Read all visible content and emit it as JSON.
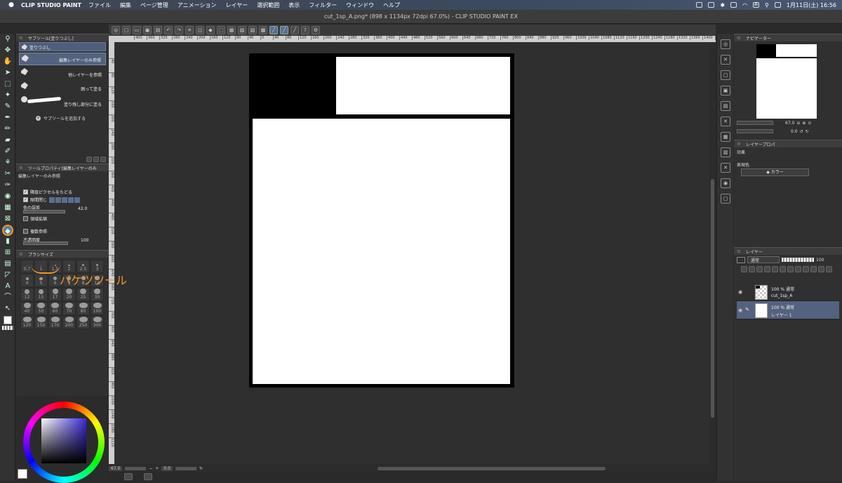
{
  "menubar": {
    "app_name": "CLIP STUDIO PAINT",
    "items": [
      "ファイル",
      "編集",
      "ページ管理",
      "アニメーション",
      "レイヤー",
      "選択範囲",
      "表示",
      "フィルター",
      "ウィンドウ",
      "ヘルプ"
    ],
    "clock": "1月11日(土) 16:56",
    "ime": "あ"
  },
  "window": {
    "title": "cut_1sp_A.png* (898 x 1134px 72dpi 67.0%)  - CLIP STUDIO PAINT EX"
  },
  "subtool_panel": {
    "header": "サブツール[塗りつぶし]",
    "tab_label": "塗りつぶし",
    "items": [
      {
        "label": "編集レイヤーのみ参照",
        "selected": true
      },
      {
        "label": "他レイヤーを参照",
        "selected": false
      },
      {
        "label": "囲って塗る",
        "selected": false
      },
      {
        "label": "塗り残し部分に塗る",
        "selected": false
      }
    ],
    "add_label": "サブツールを追加する"
  },
  "tool_property": {
    "header": "ツールプロパティ[編集レイヤーのみ",
    "subtitle": "編集レイヤーのみ参照",
    "adjacent_label": "隣接ピクセルをたどる",
    "close_gap_label": "隙間閉じ",
    "tolerance_label": "色の誤差",
    "tolerance_value": "42.0",
    "area_scaling_label": "領域拡縮",
    "multi_ref_label": "複数参照",
    "opacity_label": "不透明度",
    "opacity_value": "100"
  },
  "brush_size": {
    "header": "ブラシサイズ",
    "sizes": [
      "0.7",
      "1",
      "1.5",
      "2",
      "2.5",
      "3",
      "4",
      "5",
      "6",
      "7",
      "8",
      "10",
      "12",
      "15",
      "17",
      "20",
      "25",
      "30",
      "40",
      "50",
      "60",
      "70",
      "80",
      "100",
      "120",
      "150",
      "170",
      "200",
      "250",
      "300"
    ]
  },
  "status": {
    "zoom": "67.0",
    "rotation": "0.0"
  },
  "navigator": {
    "header": "ナビゲーター",
    "zoom_value": "67.0",
    "rotation_value": "0.0"
  },
  "layer_property": {
    "header": "レイヤープロパ",
    "effect_label": "効果",
    "expression_label": "表現色",
    "expression_value": "カラー"
  },
  "layers_panel": {
    "header": "レイヤー",
    "blend_mode": "通常",
    "opacity": "100",
    "layers": [
      {
        "mode": "100 % 通常",
        "name": "cut_1sp_A",
        "selected": false
      },
      {
        "mode": "100 % 通常",
        "name": "レイヤー 1",
        "selected": true
      }
    ]
  },
  "annotation": {
    "text": "バケツツール",
    "color": "#f0962a"
  },
  "ruler": {
    "top_ticks": [
      "400",
      "360",
      "320",
      "280",
      "240",
      "200",
      "160",
      "120",
      "80",
      "40",
      "0",
      "40",
      "80",
      "120",
      "160",
      "200",
      "240",
      "280",
      "320",
      "360",
      "400",
      "440",
      "480",
      "520",
      "560",
      "600",
      "640",
      "680",
      "720",
      "760",
      "800",
      "840",
      "880",
      "920",
      "960",
      "1000",
      "1040",
      "1080",
      "1120",
      "1160",
      "1200",
      "1240",
      "1280",
      "1320",
      "1360",
      "1400",
      "1440",
      "1480"
    ],
    "left_ticks": [
      "40",
      "80",
      "120",
      "160",
      "200",
      "240",
      "280",
      "320",
      "360",
      "400",
      "440",
      "480",
      "520",
      "560",
      "600",
      "640",
      "680",
      "720",
      "760",
      "800",
      "840",
      "880",
      "920",
      "960",
      "1000",
      "1040",
      "1080",
      "1120"
    ]
  }
}
